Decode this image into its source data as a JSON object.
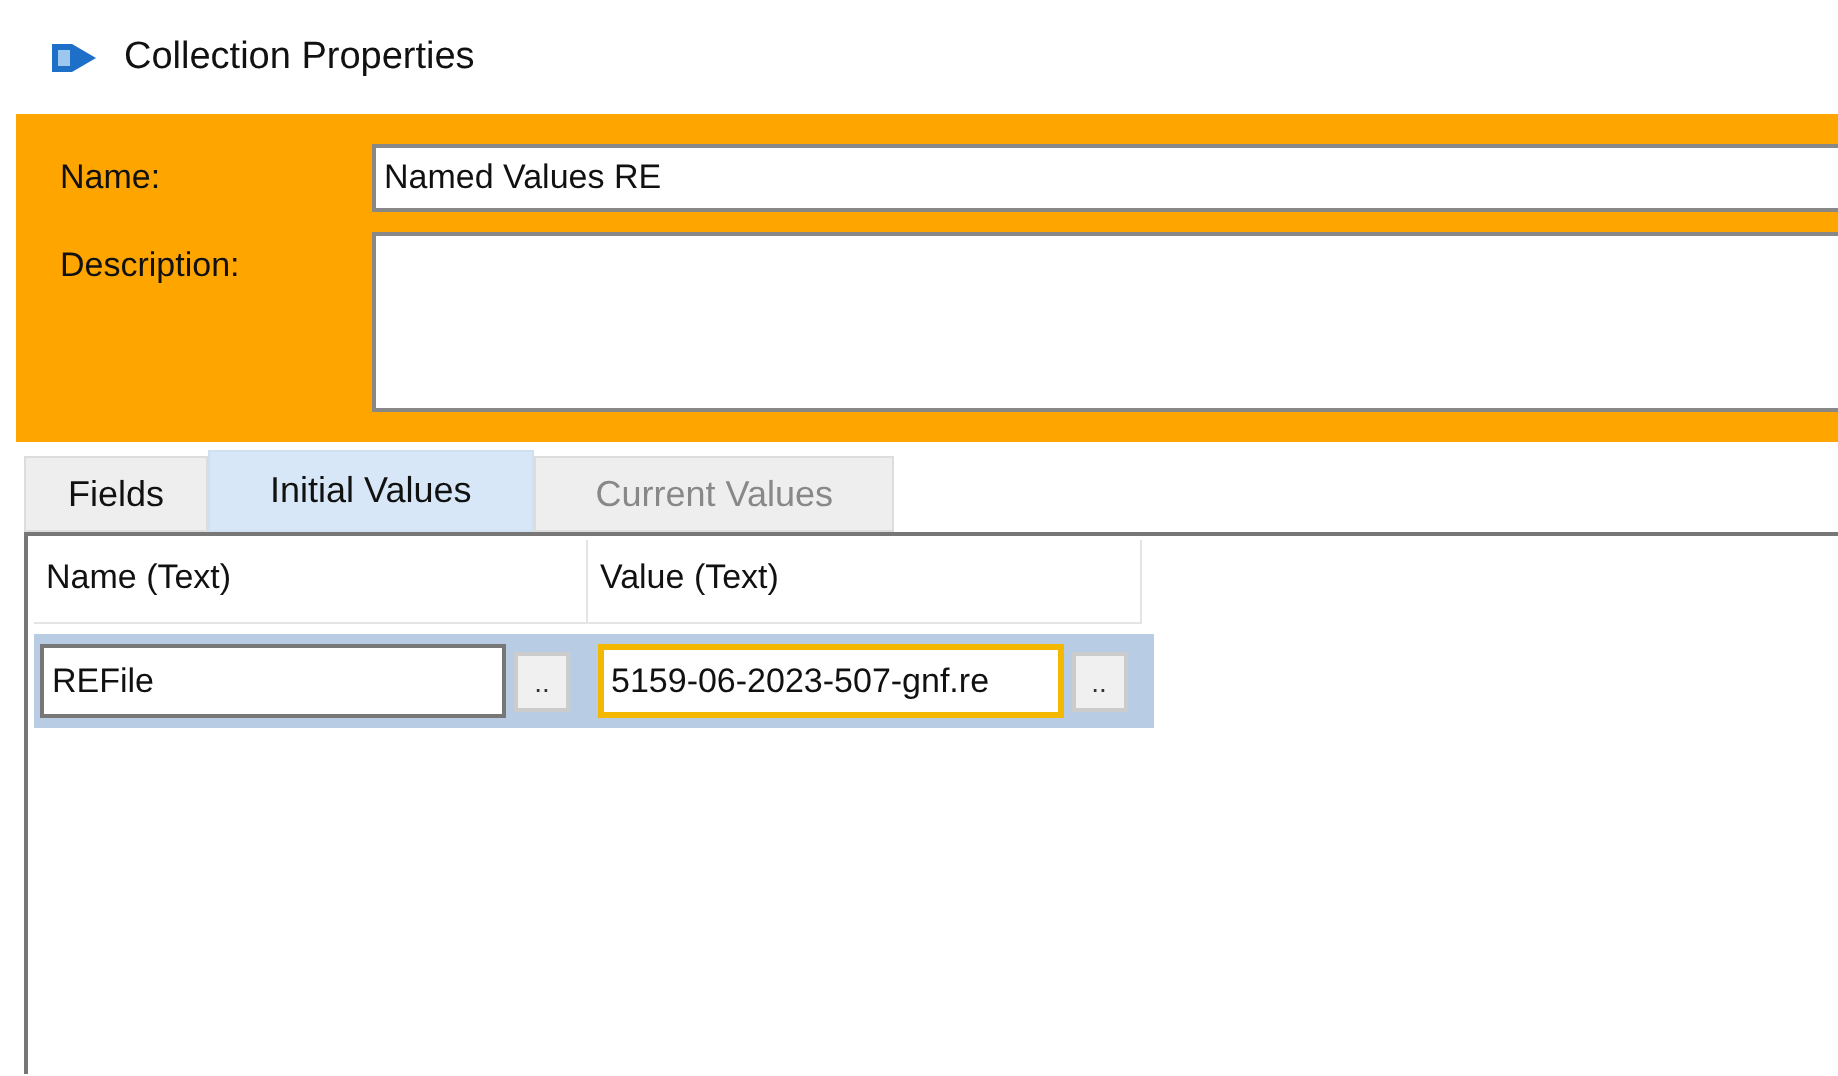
{
  "window": {
    "title": "Collection Properties"
  },
  "properties": [
    {
      "label": "Name:",
      "value": "Named Values RE",
      "kind": "line"
    },
    {
      "label": "Description:",
      "kind": "area"
    }
  ],
  "tabs": [
    {
      "label": "Fields",
      "selected": false,
      "disabled": false
    },
    {
      "label": "Initial Values",
      "selected": true,
      "disabled": false
    },
    {
      "label": "Current Values",
      "selected": false,
      "disabled": true
    }
  ],
  "grid": {
    "columns": [
      "Name  (Text)",
      "Value  (Text)"
    ],
    "rows": [
      {
        "selected": true,
        "cells": [
          {
            "value": "REFile",
            "focused": false,
            "button": ".."
          },
          {
            "value": "5159-06-2023-507-gnf.re",
            "focused": true,
            "button": ".."
          }
        ]
      }
    ]
  }
}
